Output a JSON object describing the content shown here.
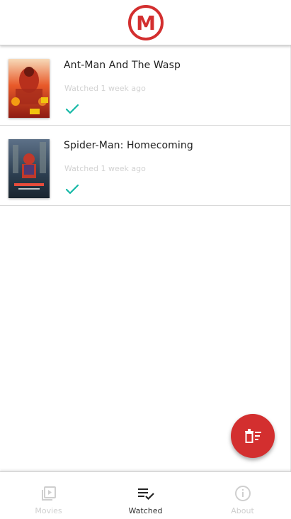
{
  "app": {
    "logo_letter": "M",
    "brand_color": "#d32f2f"
  },
  "list": {
    "items": [
      {
        "title": "Ant-Man And The Wasp",
        "subtitle": "Watched 1 week ago",
        "status_icon": "check-icon",
        "poster_colors": [
          "#c0392b",
          "#f1c40f"
        ]
      },
      {
        "title": "Spider-Man: Homecoming",
        "subtitle": "Watched 1 week ago",
        "status_icon": "check-icon",
        "poster_colors": [
          "#2c3e50",
          "#c0392b"
        ]
      }
    ],
    "check_color": "#14b8a6"
  },
  "fab": {
    "icon": "delete-list-icon",
    "color": "#d32f2f"
  },
  "bottom_nav": {
    "items": [
      {
        "label": "Movies",
        "icon": "movie-library-icon",
        "active": false
      },
      {
        "label": "Watched",
        "icon": "playlist-check-icon",
        "active": true
      },
      {
        "label": "About",
        "icon": "info-icon",
        "active": false
      }
    ]
  }
}
